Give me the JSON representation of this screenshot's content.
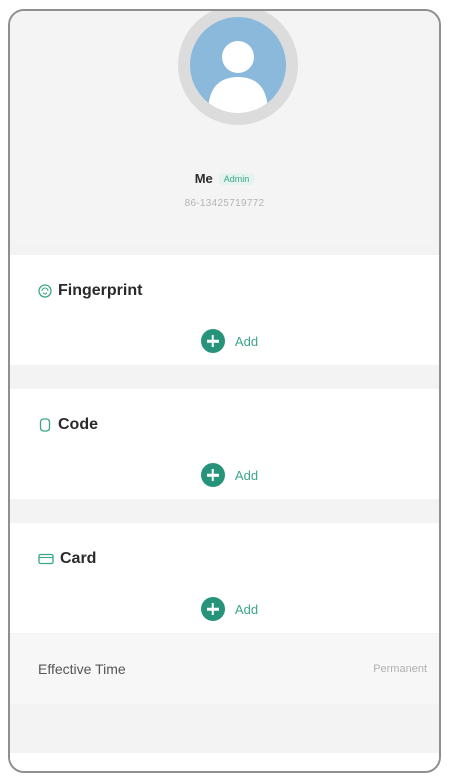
{
  "profile": {
    "name": "Me",
    "role_badge": "Admin",
    "phone": "86-13425719772"
  },
  "sections": [
    {
      "title": "Fingerprint",
      "icon": "fingerprint-icon",
      "add_label": "Add"
    },
    {
      "title": "Code",
      "icon": "keypad-icon",
      "add_label": "Add"
    },
    {
      "title": "Card",
      "icon": "card-icon",
      "add_label": "Add"
    }
  ],
  "effective_time": {
    "label": "Effective Time",
    "value": "Permanent"
  },
  "colors": {
    "accent": "#26937a",
    "accent_text": "#3aa68a",
    "avatar": "#8bb9dc"
  }
}
